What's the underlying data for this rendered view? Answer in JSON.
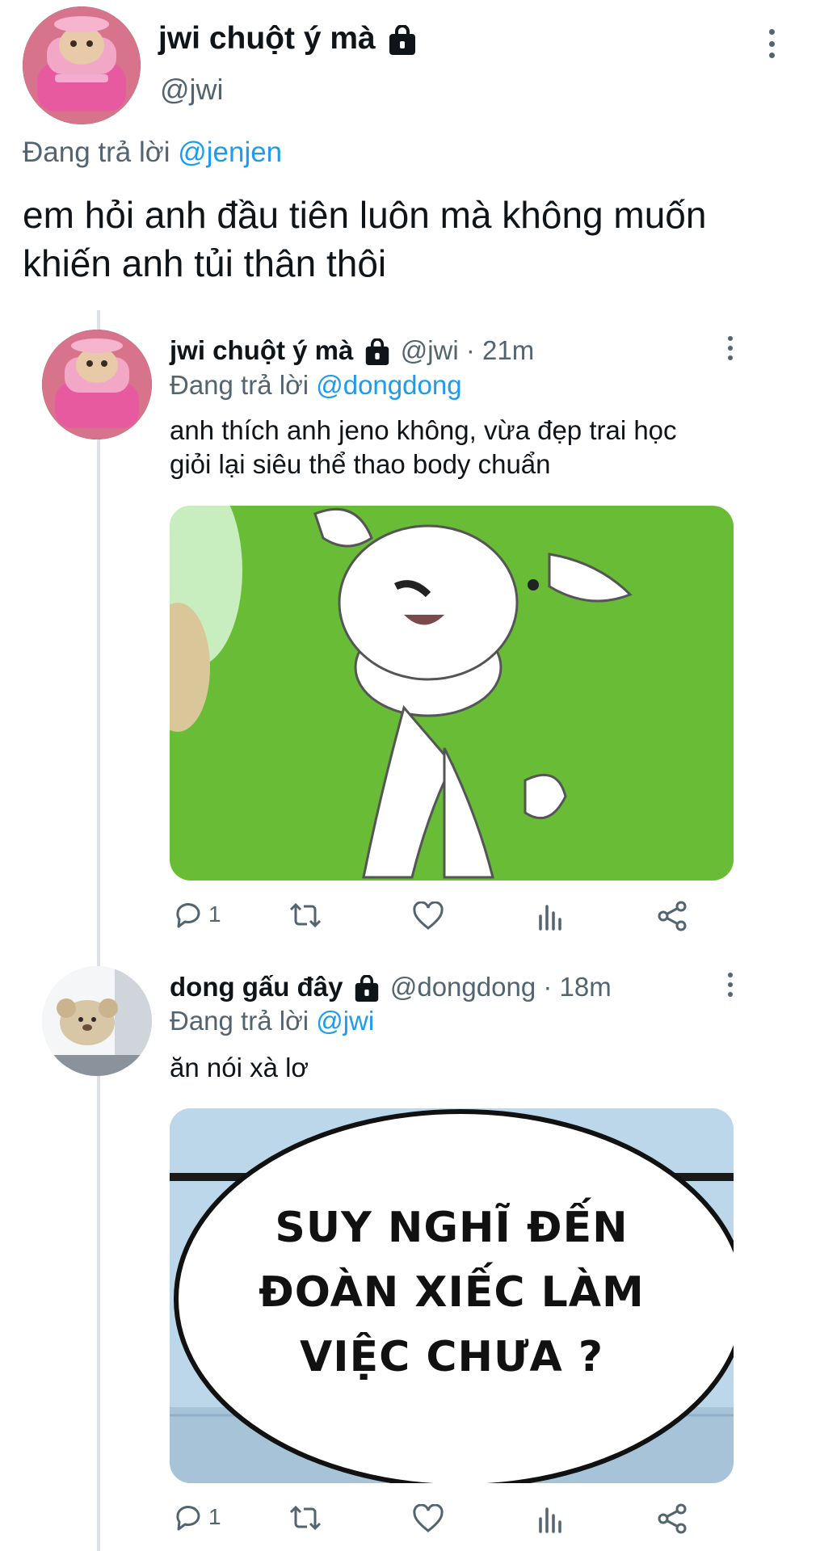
{
  "main_tweet": {
    "display_name": "jwi chuột ý mà",
    "handle": "@jwi",
    "reply_prefix": "Đang trả lời",
    "reply_to": "@jenjen",
    "text_line1": "em hỏi anh đầu tiên luôn mà không muốn",
    "text_line2": "khiến anh tủi thân thôi"
  },
  "reply1": {
    "display_name": "jwi chuột ý mà",
    "handle": "@jwi",
    "time": "· 21m",
    "reply_prefix": "Đang trả lời",
    "reply_to": "@dongdong",
    "text_line1": "anh thích anh jeno không, vừa đẹp trai học",
    "text_line2": "giỏi lại siêu thể thao body chuẩn",
    "reply_count": "1"
  },
  "reply2": {
    "display_name": "dong gấu đây",
    "handle": "@dongdong",
    "time": "· 18m",
    "reply_prefix": "Đang trả lời",
    "reply_to": "@jwi",
    "text": "ăn nói xà lơ",
    "reply_count": "1",
    "image_text_line1": "SUY NGHĨ ĐẾN",
    "image_text_line2": "ĐOÀN XIẾC LÀM",
    "image_text_line3": "VIỆC CHƯA ?"
  },
  "icons": [
    "lock-icon",
    "more-icon",
    "reply-icon",
    "retweet-icon",
    "like-icon",
    "analytics-icon",
    "share-icon"
  ],
  "colors": {
    "link": "#1d9bf0",
    "muted": "#536471",
    "thread_line": "#dbe1e6",
    "meme_green": "#6ec238"
  }
}
